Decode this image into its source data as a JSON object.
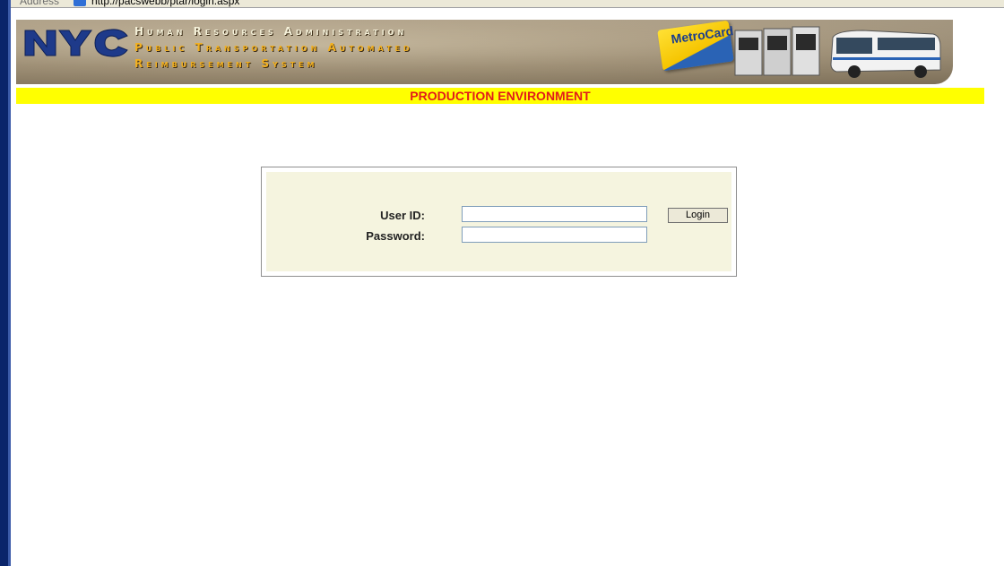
{
  "browser": {
    "address_label": "Address",
    "url": "http://pacswebb/ptar/login.aspx"
  },
  "banner": {
    "logo_text": "NYC",
    "line1": "Human Resources Administration",
    "line2": "Public Transportation Automated",
    "line3": "Reimbursement System",
    "metrocard_text": "MetroCard"
  },
  "environment": {
    "label": "PRODUCTION ENVIRONMENT",
    "bar_color": "#ffff00",
    "text_color": "#e21b1b"
  },
  "login": {
    "user_id_label": "User ID:",
    "user_id_value": "",
    "password_label": "Password:",
    "password_value": "",
    "button_label": "Login"
  },
  "colors": {
    "panel_bg": "#f5f4df",
    "banner_brown": "#a8977a",
    "logo_blue": "#1e3a8a"
  }
}
